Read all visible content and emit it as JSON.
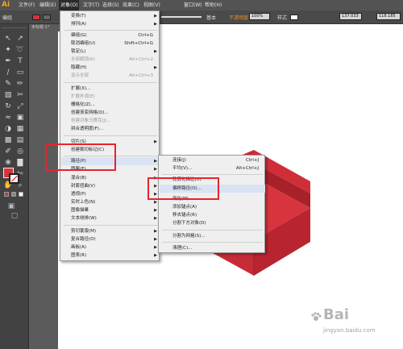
{
  "menubar": {
    "logo": "Ai",
    "items": [
      "文件(F)",
      "编辑(E)",
      "对象(O)",
      "文字(T)",
      "选择(S)",
      "效果(C)",
      "视图(V)",
      "窗口(W)",
      "帮助(H)"
    ]
  },
  "control_bar": {
    "selection_label": "编组",
    "stroke_style": "基本",
    "opacity_label": "不透明度",
    "opacity_value": "100%",
    "style_label": "样式",
    "x_value": "137.033",
    "w_value": "118.185"
  },
  "doc_tab": {
    "title": "未标题-1*"
  },
  "object_menu": {
    "items": [
      {
        "label": "变换(T)",
        "shortcut": "",
        "submenu": true,
        "disabled": false
      },
      {
        "label": "排列(A)",
        "shortcut": "",
        "submenu": true,
        "disabled": false
      },
      {
        "label": "编组(G)",
        "shortcut": "Ctrl+G",
        "submenu": false,
        "disabled": false
      },
      {
        "label": "取消编组(U)",
        "shortcut": "Shift+Ctrl+G",
        "submenu": false,
        "disabled": false
      },
      {
        "label": "锁定(L)",
        "shortcut": "",
        "submenu": true,
        "disabled": false
      },
      {
        "label": "全部解锁(K)",
        "shortcut": "Alt+Ctrl+2",
        "submenu": false,
        "disabled": true
      },
      {
        "label": "隐藏(H)",
        "shortcut": "",
        "submenu": true,
        "disabled": false
      },
      {
        "label": "显示全部",
        "shortcut": "Alt+Ctrl+3",
        "submenu": false,
        "disabled": true
      },
      {
        "label": "扩展(X)...",
        "shortcut": "",
        "submenu": false,
        "disabled": false
      },
      {
        "label": "扩展外观(E)",
        "shortcut": "",
        "submenu": false,
        "disabled": true
      },
      {
        "label": "栅格化(Z)...",
        "shortcut": "",
        "submenu": false,
        "disabled": false
      },
      {
        "label": "创建渐变网格(D)...",
        "shortcut": "",
        "submenu": false,
        "disabled": false
      },
      {
        "label": "创建对象马赛克(J)...",
        "shortcut": "",
        "submenu": false,
        "disabled": true
      },
      {
        "label": "拼合透明度(F)...",
        "shortcut": "",
        "submenu": false,
        "disabled": false
      },
      {
        "label": "切片(S)",
        "shortcut": "",
        "submenu": true,
        "disabled": false
      },
      {
        "label": "创建裁切标记(C)",
        "shortcut": "",
        "submenu": false,
        "disabled": false
      },
      {
        "label": "路径(P)",
        "shortcut": "",
        "submenu": true,
        "disabled": false
      },
      {
        "label": "图案(E)",
        "shortcut": "",
        "submenu": true,
        "disabled": false
      },
      {
        "label": "混合(B)",
        "shortcut": "",
        "submenu": true,
        "disabled": false
      },
      {
        "label": "封套扭曲(V)",
        "shortcut": "",
        "submenu": true,
        "disabled": false
      },
      {
        "label": "透视(P)",
        "shortcut": "",
        "submenu": true,
        "disabled": false
      },
      {
        "label": "实时上色(N)",
        "shortcut": "",
        "submenu": true,
        "disabled": false
      },
      {
        "label": "图像描摹",
        "shortcut": "",
        "submenu": true,
        "disabled": false
      },
      {
        "label": "文本绕排(W)",
        "shortcut": "",
        "submenu": true,
        "disabled": false
      },
      {
        "label": "剪切蒙版(M)",
        "shortcut": "",
        "submenu": true,
        "disabled": false
      },
      {
        "label": "复合路径(O)",
        "shortcut": "",
        "submenu": true,
        "disabled": false
      },
      {
        "label": "画板(A)",
        "shortcut": "",
        "submenu": true,
        "disabled": false
      },
      {
        "label": "图表(R)",
        "shortcut": "",
        "submenu": true,
        "disabled": false
      }
    ]
  },
  "path_submenu": {
    "items": [
      {
        "label": "连接(J)",
        "shortcut": "Ctrl+J"
      },
      {
        "label": "平均(V)...",
        "shortcut": "Alt+Ctrl+J"
      },
      {
        "label": "轮廓化描边(U)",
        "shortcut": ""
      },
      {
        "label": "偏移路径(O)...",
        "shortcut": ""
      },
      {
        "label": "简化(M)...",
        "shortcut": ""
      },
      {
        "label": "添加锚点(A)",
        "shortcut": ""
      },
      {
        "label": "移去锚点(R)",
        "shortcut": ""
      },
      {
        "label": "分割下方对象(D)",
        "shortcut": ""
      },
      {
        "label": "分割为网格(S)...",
        "shortcut": ""
      },
      {
        "label": "清理(C)...",
        "shortcut": ""
      }
    ]
  },
  "watermark": {
    "text": "Bai",
    "url": "jingyan.baidu.com"
  },
  "colors": {
    "fill": "#d6343c",
    "art_top": "#d8343d",
    "art_side": "#b82530",
    "highlight_box": "#e8232e",
    "menubar_bg": "#535353",
    "menu_bg": "#efefef"
  }
}
